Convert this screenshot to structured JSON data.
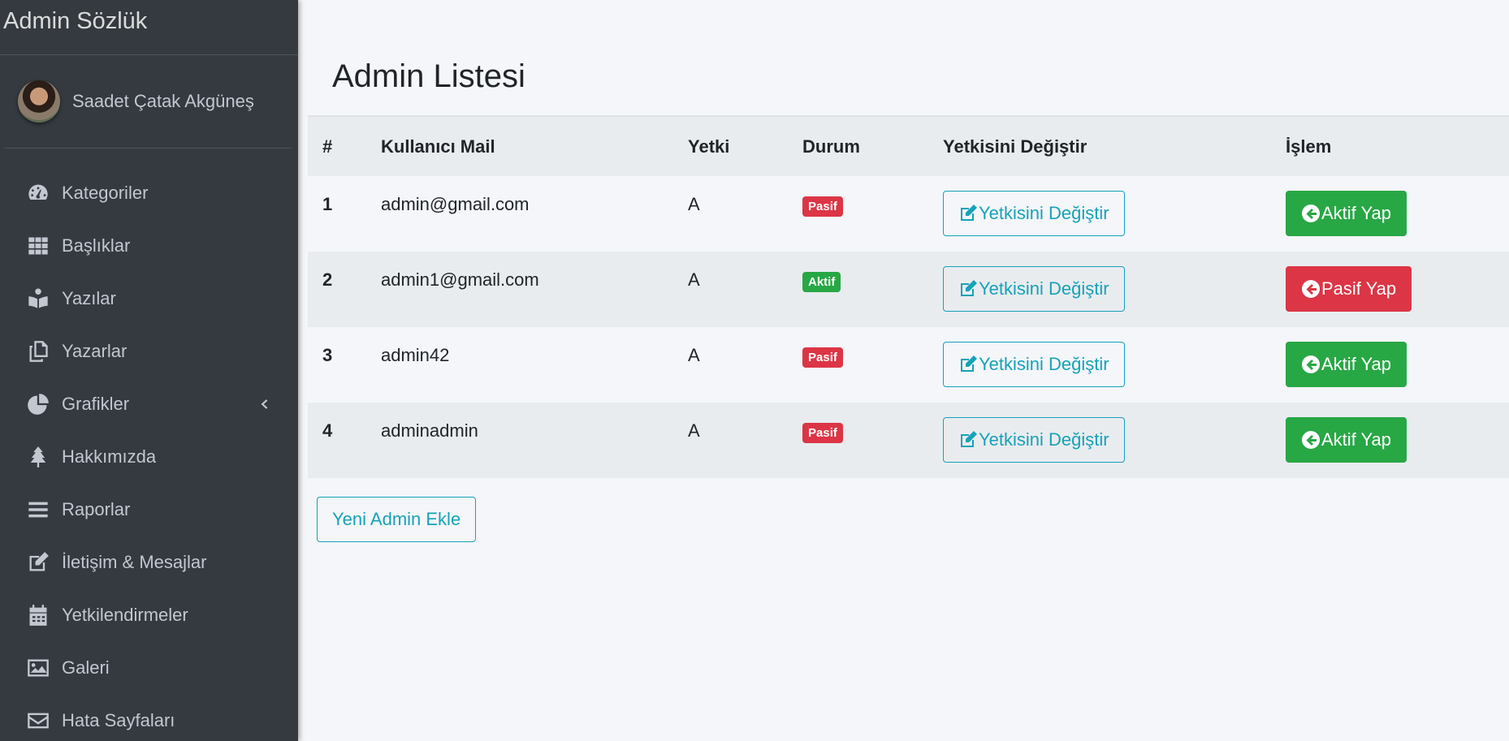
{
  "brand": "Admin Sözlük",
  "user": {
    "name": "Saadet Çatak Akgüneş"
  },
  "sidebar": {
    "items": [
      {
        "label": "Kategoriler",
        "icon": "tachometer-icon"
      },
      {
        "label": "Başlıklar",
        "icon": "grid-icon"
      },
      {
        "label": "Yazılar",
        "icon": "book-reader-icon"
      },
      {
        "label": "Yazarlar",
        "icon": "copy-icon"
      },
      {
        "label": "Grafikler",
        "icon": "chart-pie-icon"
      },
      {
        "label": "Hakkımızda",
        "icon": "tree-icon"
      },
      {
        "label": "Raporlar",
        "icon": "bars-icon"
      },
      {
        "label": "İletişim & Mesajlar",
        "icon": "edit-icon"
      },
      {
        "label": "Yetkilendirmeler",
        "icon": "calendar-icon"
      },
      {
        "label": "Galeri",
        "icon": "image-icon"
      },
      {
        "label": "Hata Sayfaları",
        "icon": "envelope-icon"
      }
    ]
  },
  "page": {
    "title": "Admin Listesi"
  },
  "table": {
    "headers": [
      "#",
      "Kullanıcı Mail",
      "Yetki",
      "Durum",
      "Yetkisini Değiştir",
      "İşlem"
    ],
    "rows": [
      {
        "id": "1",
        "mail": "admin@gmail.com",
        "role": "A",
        "status": "Pasif",
        "change_label": "Yetkisini Değiştir",
        "action_label": "Aktif Yap"
      },
      {
        "id": "2",
        "mail": "admin1@gmail.com",
        "role": "A",
        "status": "Aktif",
        "change_label": "Yetkisini Değiştir",
        "action_label": "Pasif Yap"
      },
      {
        "id": "3",
        "mail": "admin42",
        "role": "A",
        "status": "Pasif",
        "change_label": "Yetkisini Değiştir",
        "action_label": "Aktif Yap"
      },
      {
        "id": "4",
        "mail": "adminadmin",
        "role": "A",
        "status": "Pasif",
        "change_label": "Yetkisini Değiştir",
        "action_label": "Aktif Yap"
      }
    ]
  },
  "add_button": "Yeni Admin Ekle",
  "colors": {
    "sidebar_bg": "#343a40",
    "info": "#17a2b8",
    "success": "#28a745",
    "danger": "#dc3545"
  }
}
